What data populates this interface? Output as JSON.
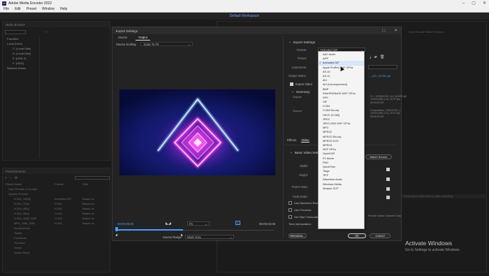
{
  "window": {
    "app_icon_text": "Me",
    "title": "Adobe Media Encoder 2022",
    "controls": [
      "–",
      "▢",
      "✕"
    ]
  },
  "menu": {
    "items": [
      "File",
      "Edit",
      "Preset",
      "Window",
      "Help"
    ]
  },
  "workspace": {
    "label": "Default Workspace"
  },
  "left_panel": {
    "items": [
      "Favorites",
      "Local Drives",
      "C: (Local Disk)",
      "D: (Local Disk)",
      "E: (HDD 2)",
      "F: (HDD)",
      "Network Drives"
    ]
  },
  "preset_browser": {
    "rows": [
      "Preset Name",
      "User Presets & Groups",
      "System Presets",
      "H.264_1080p",
      "H.264_720p",
      "H.264_480p",
      "H.264_360p",
      "H.264_1080_SAR",
      "MP4_1080_SAR",
      "Social Media",
      "Twitter",
      "Facebook",
      "YouTube",
      "Vimeo",
      "Adobe Stock"
    ],
    "col2": [
      "Format",
      "",
      "",
      "Animated GIF",
      "H.264",
      "H.264",
      "H.264",
      "H.264",
      "H.264",
      "",
      "",
      "",
      "",
      "",
      ""
    ],
    "col3": [
      "Path",
      "",
      "",
      "Based on",
      "Based on",
      "Based on",
      "Based on",
      "Based on",
      "Based on",
      "",
      "",
      "",
      "",
      "",
      ""
    ]
  },
  "dialog": {
    "title": "Export Settings",
    "tabs": [
      "Source",
      "Output"
    ],
    "active_tab": "Output",
    "source_scaling_label": "Source Scaling:",
    "source_scaling_value": "Scale To Fit",
    "timecode_in": "00;00;00;00",
    "timecode_out": "00;00;02;05",
    "fit_value": "Fit",
    "source_range_label": "Source Range:",
    "source_range_value": "Work Area",
    "metadata_button": "Metadata...",
    "ok_button": "OK",
    "cancel_button": "Cancel"
  },
  "export_settings": {
    "section_title": "Export Settings",
    "format_label": "Format:",
    "format_value": "Animated GIF",
    "preset_label": "Preset:",
    "comments_label": "Comments:",
    "output_name_label": "Output Name:",
    "output_name_value": "…_NO_NOISE.gif",
    "export_video_label": "Export Video",
    "summary_title": "Summary",
    "output_label": "Output:",
    "output_lines": [
      "C:\\...\\CREATIVE_NO_NOISE.gif",
      "1920x1080 (1.0), 29.97 fps",
      "00;00;02;05"
    ],
    "source_label": "Source:",
    "source_lines": [
      "Composition, CREATIVE_1",
      "1920x1080 (1.0), 29.97 fps",
      "00;00;02;05"
    ],
    "tabs": [
      "Effects",
      "Video"
    ],
    "active_tab": "Video",
    "basic_video_title": "Basic Video Settings",
    "width_label": "Width:",
    "height_label": "Height:",
    "frame_rate_label": "Frame Rate:",
    "field_order_label": "Field Order:",
    "match_source_label": "Match Source",
    "use_max_render_label": "Use Maximum Render Quality",
    "use_previews_label": "Use Previews",
    "set_start_tc_label": "Set Start Timecode",
    "time_interp_label": "Time Interpolation:",
    "render_alpha_label": "Render Alpha Channel Only"
  },
  "dropdown": {
    "selected": "Animated GIF",
    "options": [
      "AAC Audio",
      "AIFF",
      "Animated GIF",
      "Apple ProRes MXF OP1a",
      "AS-10",
      "AS-11",
      "AVI",
      "AVI (Uncompressed)",
      "BMP",
      "DNxHR/DNxHD MXF OP1a",
      "DPX",
      "GIF",
      "H.264",
      "H.264 Blu-ray",
      "HEVC (H.265)",
      "JPEG",
      "JPEG 2000 MXF OP1a",
      "MP3",
      "MPEG2",
      "MPEG2 Blu-ray",
      "MPEG2-DVD",
      "MPEG4",
      "MXF OP1a",
      "OpenEXR",
      "P2 Movie",
      "PNG",
      "QuickTime",
      "Targa",
      "TIFF",
      "Waveform Audio",
      "Windows Media",
      "Wraptor DCP"
    ]
  },
  "right_panel": {
    "queue_hint": "Auto-Encode Watch Folders",
    "watch_hint": "Drag source files here to start encoding"
  },
  "activation": {
    "title": "Activate Windows",
    "subtitle": "Go to Settings to activate Windows."
  }
}
